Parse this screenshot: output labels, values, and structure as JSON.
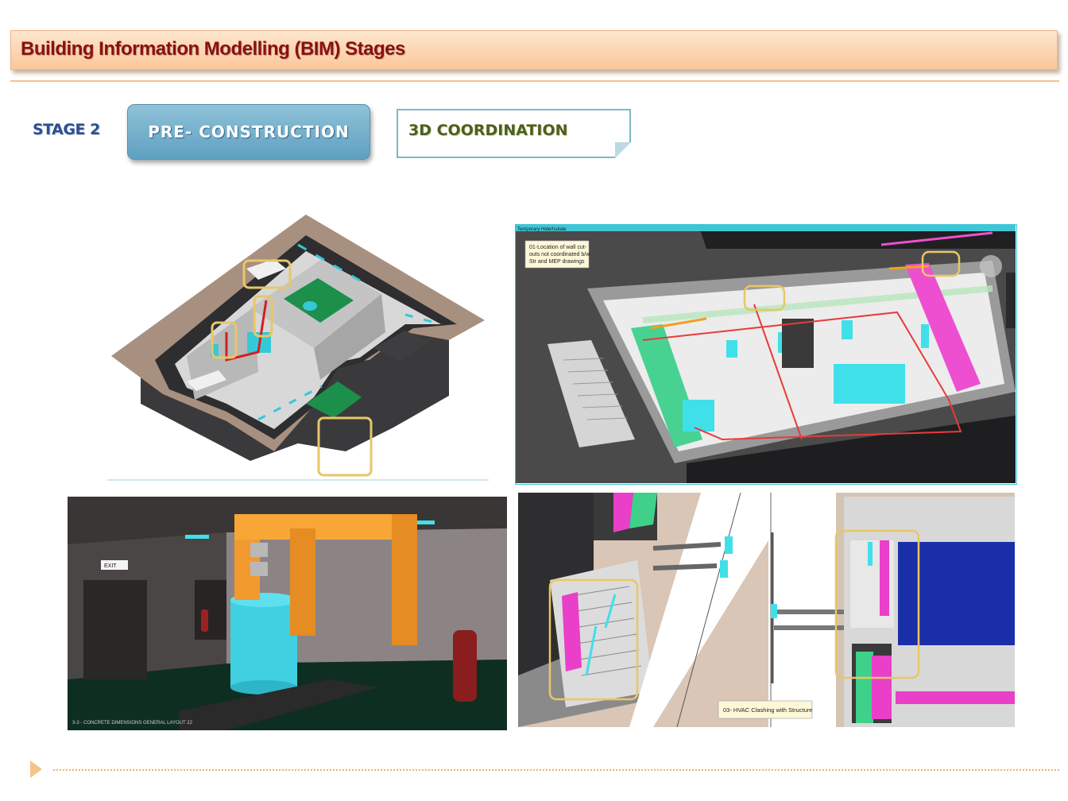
{
  "header": {
    "title": "Building Information Modelling (BIM) Stages"
  },
  "stage": {
    "label": "STAGE 2",
    "phase_button": "PRE- CONSTRUCTION",
    "activity": "3D COORDINATION"
  },
  "images": {
    "top_right": {
      "toolbar_text": "Temporary Hide/Isolate",
      "note": [
        "01-Location of wall cut-",
        "outs not coordinated b/w",
        "Str and MEP drawings"
      ]
    },
    "bottom_left": {
      "exit_sign": "EXIT",
      "caption": "3-3 - CONCRETE DIMENSIONS GENERAL LAYOUT 22"
    },
    "bottom_right": {
      "note": "03- HVAC Clashing with Structure"
    }
  },
  "colors": {
    "title_text": "#8b1010",
    "title_bar": "#fbc79a",
    "stage_text": "#2c4f90",
    "phase_button": "#6fabc8",
    "activity_text": "#4e5e1e",
    "highlight_box": "#e7c766",
    "duct_cyan": "#3fe0ea",
    "duct_magenta": "#e93fc9",
    "duct_green": "#3fd08a",
    "duct_orange": "#f39a2e"
  }
}
